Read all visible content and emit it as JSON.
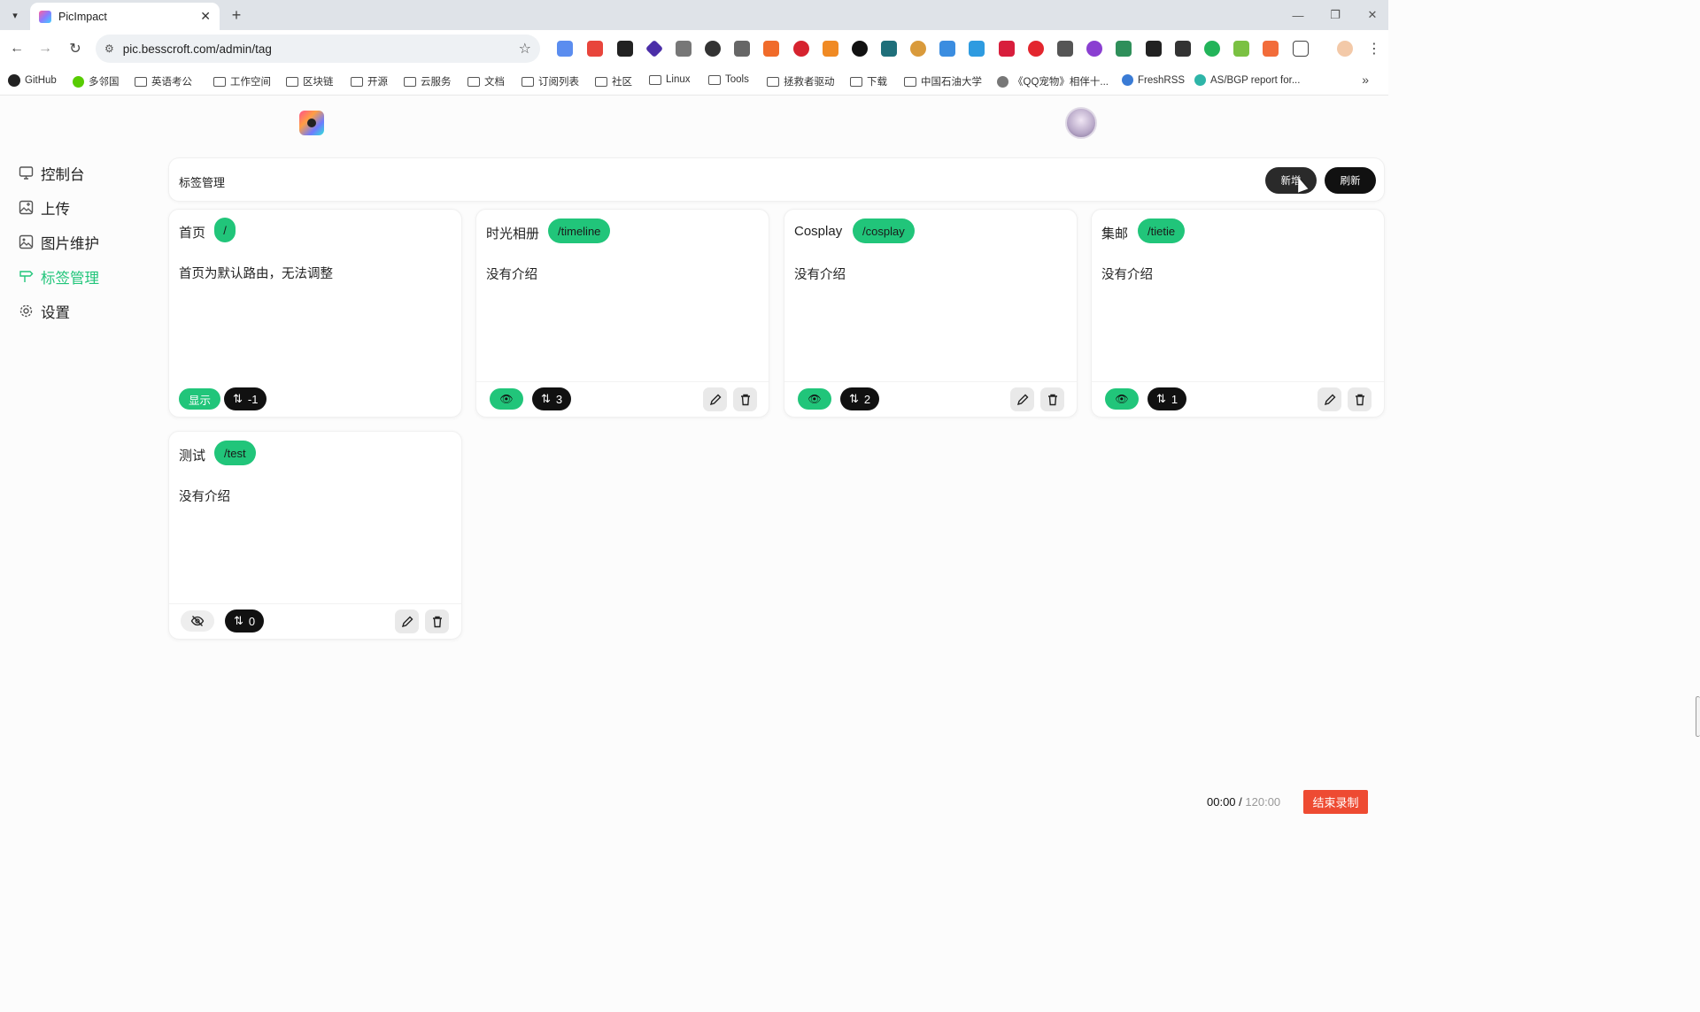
{
  "browser": {
    "tab_title": "PicImpact",
    "url": "pic.besscroft.com/admin/tag",
    "bookmarks": [
      "GitHub",
      "多邻国",
      "英语考公",
      "工作空间",
      "区块链",
      "开源",
      "云服务",
      "文档",
      "订阅列表",
      "社区",
      "Linux",
      "Tools",
      "拯救者驱动",
      "下载",
      "中国石油大学",
      "《QQ宠物》相伴十...",
      "FreshRSS",
      "AS/BGP report for..."
    ]
  },
  "sidebar": {
    "items": [
      {
        "label": "控制台",
        "icon": "monitor-icon"
      },
      {
        "label": "上传",
        "icon": "image-upload-icon"
      },
      {
        "label": "图片维护",
        "icon": "image-icon"
      },
      {
        "label": "标签管理",
        "icon": "signpost-icon"
      },
      {
        "label": "设置",
        "icon": "gear-icon"
      }
    ]
  },
  "header": {
    "title": "标签管理",
    "add_label": "新增",
    "refresh_label": "刷新"
  },
  "tags": [
    {
      "name": "首页",
      "route": "/",
      "desc": "首页为默认路由，无法调整",
      "visible_label": "显示",
      "sort": "-1"
    },
    {
      "name": "时光相册",
      "route": "/timeline",
      "desc": "没有介绍",
      "sort": "3"
    },
    {
      "name": "Cosplay",
      "route": "/cosplay",
      "desc": "没有介绍",
      "sort": "2"
    },
    {
      "name": "集邮",
      "route": "/tietie",
      "desc": "没有介绍",
      "sort": "1"
    },
    {
      "name": "测试",
      "route": "/test",
      "desc": "没有介绍",
      "sort": "0"
    }
  ],
  "recorder": {
    "elapsed": "00:00",
    "separator": " / ",
    "max": "120:00",
    "end_label": "结束录制"
  },
  "colors": {
    "accent": "#21c57a",
    "dark": "#111111",
    "record": "#ee4b32"
  }
}
